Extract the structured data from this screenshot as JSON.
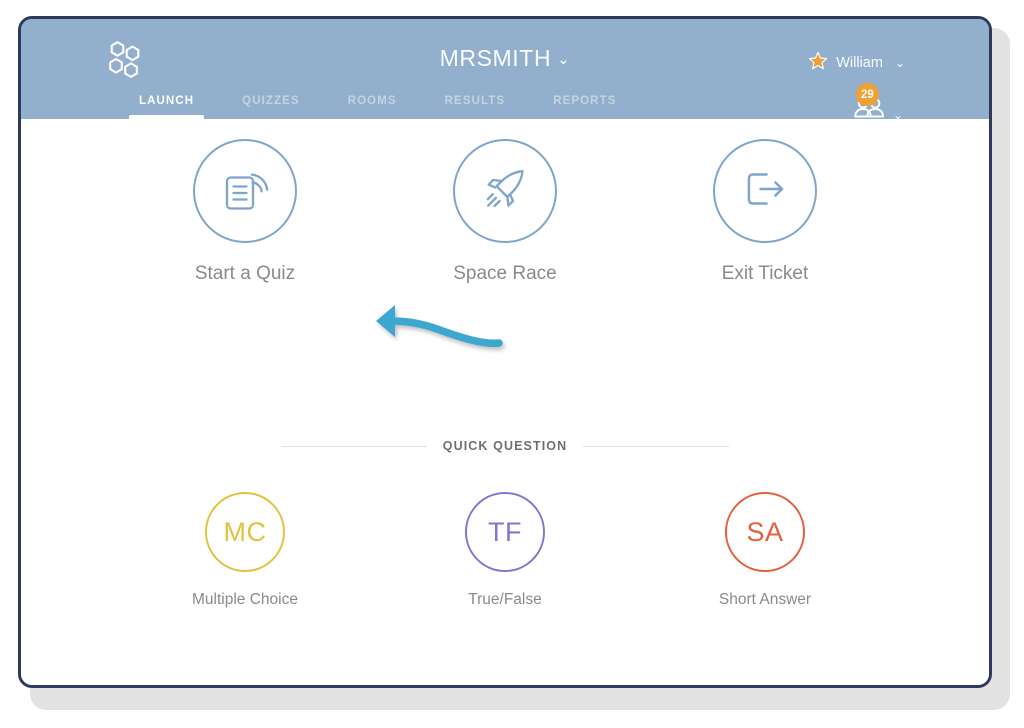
{
  "header": {
    "logo_icon": "honeycomb-logo-icon",
    "title": "MRSMITH",
    "title_chevron": "⌄",
    "user": {
      "star_icon": "star-icon",
      "name": "William",
      "chevron": "⌄"
    },
    "roster": {
      "count": "29",
      "people_icon": "people-group-icon",
      "chevron": "⌄"
    },
    "background_color": "#92afcd"
  },
  "nav": {
    "tabs": [
      {
        "label": "LAUNCH",
        "active": true
      },
      {
        "label": "QUIZZES",
        "active": false
      },
      {
        "label": "ROOMS",
        "active": false
      },
      {
        "label": "RESULTS",
        "active": false
      },
      {
        "label": "REPORTS",
        "active": false
      }
    ]
  },
  "main": {
    "primary_actions": [
      {
        "label": "Start a Quiz",
        "icon": "document-broadcast-icon",
        "color": "#7fa5cb"
      },
      {
        "label": "Space Race",
        "icon": "rocket-icon",
        "color": "#7fa5cb"
      },
      {
        "label": "Exit Ticket",
        "icon": "exit-door-arrow-icon",
        "color": "#7fa5cb"
      }
    ],
    "quick_question": {
      "section_title": "QUICK QUESTION",
      "items": [
        {
          "abbr": "MC",
          "label": "Multiple Choice",
          "color": "#e0c23c"
        },
        {
          "abbr": "TF",
          "label": "True/False",
          "color": "#7f78cd"
        },
        {
          "abbr": "SA",
          "label": "Short Answer",
          "color": "#e2603e"
        }
      ]
    },
    "annotation": {
      "arrow_icon": "curved-left-arrow-annotation",
      "color": "#3ea8cf"
    }
  },
  "colors": {
    "header": "#92afcd",
    "window_border": "#2e3a5c",
    "accent_blue": "#7fa5cb",
    "badge_orange": "#f0a132",
    "annotation_cyan": "#3ea8cf"
  }
}
